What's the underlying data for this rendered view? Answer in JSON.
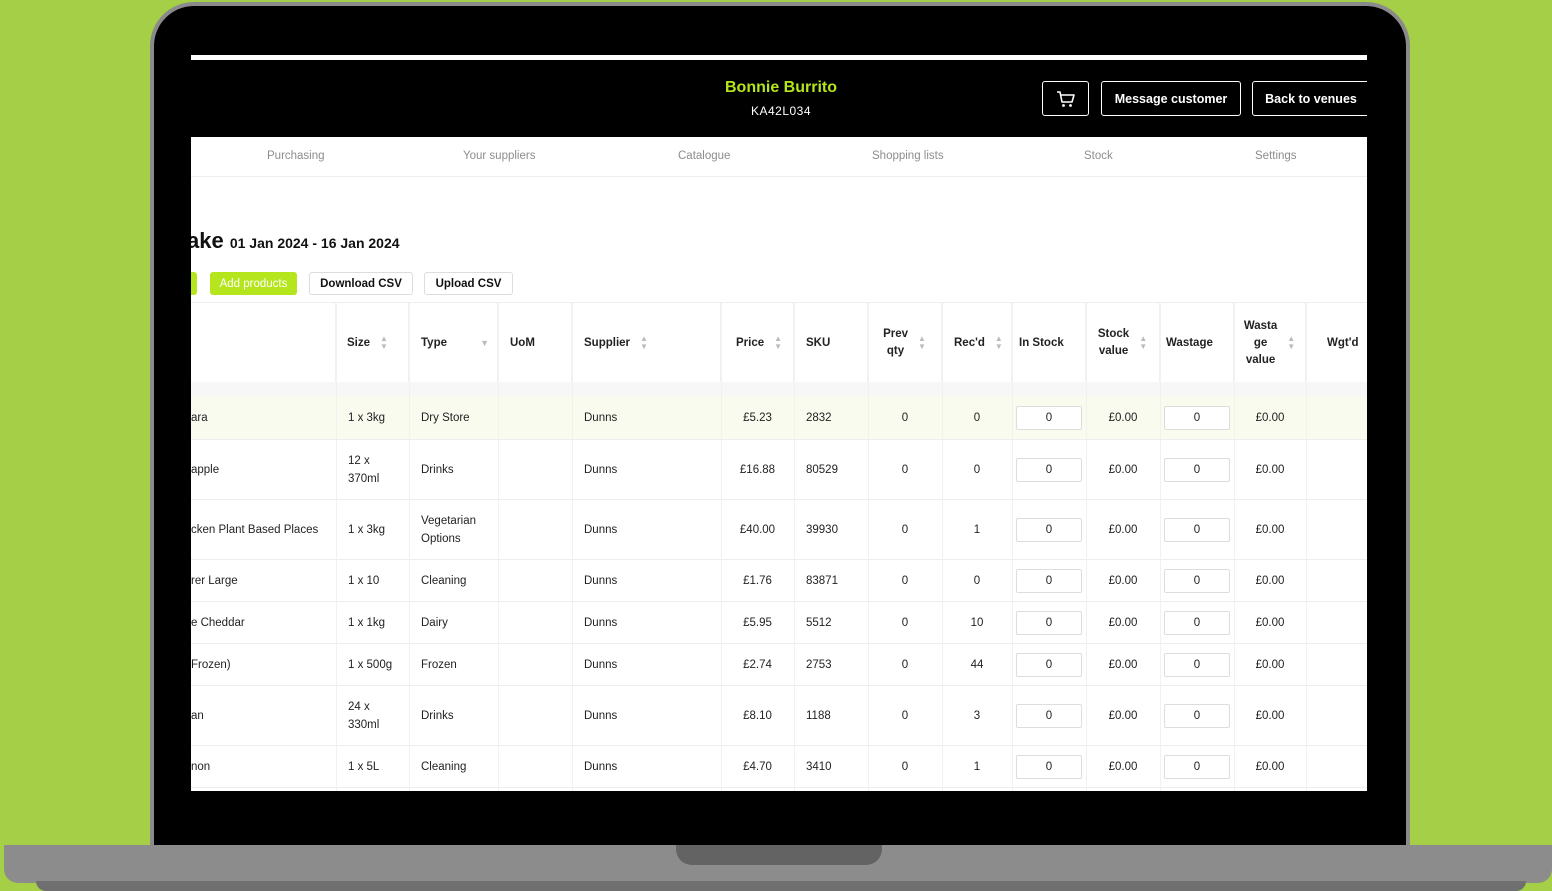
{
  "venue": {
    "name": "Bonnie Burrito",
    "code": "KA42L034"
  },
  "header_buttons": {
    "message": "Message customer",
    "back": "Back to venues"
  },
  "nav": [
    "Purchasing",
    "Your suppliers",
    "Catalogue",
    "Shopping lists",
    "Stock",
    "Settings"
  ],
  "page": {
    "title": "ake",
    "date_range": "01 Jan 2024 - 16 Jan 2024"
  },
  "toolbar": {
    "add": "Add products",
    "download": "Download CSV",
    "upload": "Upload CSV"
  },
  "columns": {
    "size": "Size",
    "type": "Type",
    "uom": "UoM",
    "supplier": "Supplier",
    "price": "Price",
    "sku": "SKU",
    "prev_qty_1": "Prev",
    "prev_qty_2": "qty",
    "recd": "Rec'd",
    "in_stock": "In Stock",
    "stock_value_1": "Stock",
    "stock_value_2": "value",
    "wastage": "Wastage",
    "wastage_value_1": "Wasta",
    "wastage_value_2": "ge",
    "wastage_value_3": "value",
    "wgtd": "Wgt'd"
  },
  "rows": [
    {
      "name": "ara",
      "size_1": "1 x 3kg",
      "size_2": "",
      "type_1": "Dry Store",
      "type_2": "",
      "supplier": "Dunns",
      "price": "£5.23",
      "sku": "2832",
      "prev_qty": "0",
      "recd": "0",
      "in_stock": "0",
      "stock_value": "£0.00",
      "wastage": "0",
      "wastage_value": "£0.00"
    },
    {
      "name": "apple",
      "size_1": "12 x",
      "size_2": "370ml",
      "type_1": "Drinks",
      "type_2": "",
      "supplier": "Dunns",
      "price": "£16.88",
      "sku": "80529",
      "prev_qty": "0",
      "recd": "0",
      "in_stock": "0",
      "stock_value": "£0.00",
      "wastage": "0",
      "wastage_value": "£0.00"
    },
    {
      "name": "cken Plant Based Places",
      "size_1": "1 x 3kg",
      "size_2": "",
      "type_1": "Vegetarian",
      "type_2": "Options",
      "supplier": "Dunns",
      "price": "£40.00",
      "sku": "39930",
      "prev_qty": "0",
      "recd": "1",
      "in_stock": "0",
      "stock_value": "£0.00",
      "wastage": "0",
      "wastage_value": "£0.00"
    },
    {
      "name": "rer Large",
      "size_1": "1 x 10",
      "size_2": "",
      "type_1": "Cleaning",
      "type_2": "",
      "supplier": "Dunns",
      "price": "£1.76",
      "sku": "83871",
      "prev_qty": "0",
      "recd": "0",
      "in_stock": "0",
      "stock_value": "£0.00",
      "wastage": "0",
      "wastage_value": "£0.00"
    },
    {
      "name": "e Cheddar",
      "size_1": "1 x 1kg",
      "size_2": "",
      "type_1": "Dairy",
      "type_2": "",
      "supplier": "Dunns",
      "price": "£5.95",
      "sku": "5512",
      "prev_qty": "0",
      "recd": "10",
      "in_stock": "0",
      "stock_value": "£0.00",
      "wastage": "0",
      "wastage_value": "£0.00"
    },
    {
      "name": "Frozen)",
      "size_1": "1 x 500g",
      "size_2": "",
      "type_1": "Frozen",
      "type_2": "",
      "supplier": "Dunns",
      "price": "£2.74",
      "sku": "2753",
      "prev_qty": "0",
      "recd": "44",
      "in_stock": "0",
      "stock_value": "£0.00",
      "wastage": "0",
      "wastage_value": "£0.00"
    },
    {
      "name": "an",
      "size_1": "24 x",
      "size_2": "330ml",
      "type_1": "Drinks",
      "type_2": "",
      "supplier": "Dunns",
      "price": "£8.10",
      "sku": "1188",
      "prev_qty": "0",
      "recd": "3",
      "in_stock": "0",
      "stock_value": "£0.00",
      "wastage": "0",
      "wastage_value": "£0.00"
    },
    {
      "name": "non",
      "size_1": "1 x 5L",
      "size_2": "",
      "type_1": "Cleaning",
      "type_2": "",
      "supplier": "Dunns",
      "price": "£4.70",
      "sku": "3410",
      "prev_qty": "0",
      "recd": "1",
      "in_stock": "0",
      "stock_value": "£0.00",
      "wastage": "0",
      "wastage_value": "£0.00"
    }
  ],
  "colors": {
    "accent": "#b5e61d",
    "background": "#a4cf47",
    "header": "#000000"
  },
  "icons": {
    "cart": "shopping-cart-icon",
    "sort": "sort-arrows-icon",
    "filter": "filter-funnel-icon"
  }
}
